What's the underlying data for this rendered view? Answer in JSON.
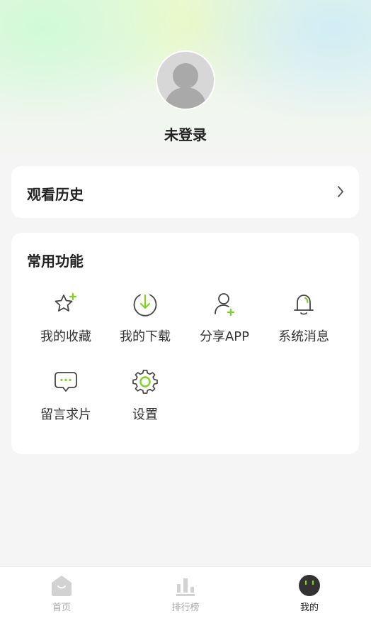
{
  "profile": {
    "username": "未登录"
  },
  "history": {
    "title": "观看历史"
  },
  "functions": {
    "title": "常用功能",
    "items": [
      {
        "label": "我的收藏",
        "icon": "star-plus-icon"
      },
      {
        "label": "我的下载",
        "icon": "download-icon"
      },
      {
        "label": "分享APP",
        "icon": "share-user-icon"
      },
      {
        "label": "系统消息",
        "icon": "bell-icon"
      },
      {
        "label": "留言求片",
        "icon": "message-icon"
      },
      {
        "label": "设置",
        "icon": "gear-icon"
      }
    ]
  },
  "tabbar": {
    "items": [
      {
        "label": "首页",
        "icon": "home-icon",
        "active": false
      },
      {
        "label": "排行榜",
        "icon": "ranking-icon",
        "active": false
      },
      {
        "label": "我的",
        "icon": "profile-face-icon",
        "active": true
      }
    ]
  },
  "colors": {
    "accent": "#7ed321",
    "icon_stroke": "#444444"
  }
}
